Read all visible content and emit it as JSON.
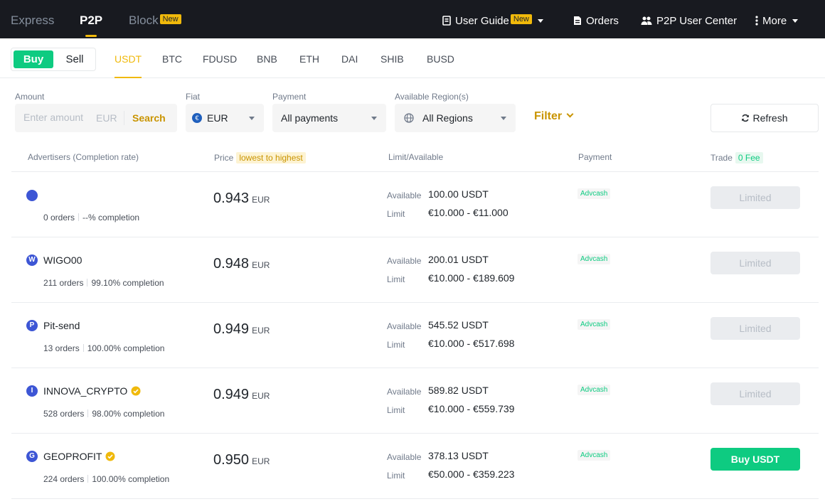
{
  "topnav": {
    "tabs": [
      {
        "label": "Express",
        "active": false
      },
      {
        "label": "P2P",
        "active": true
      },
      {
        "label": "Block",
        "active": false,
        "badge": "New"
      }
    ],
    "right": {
      "user_guide": "User Guide",
      "user_guide_badge": "New",
      "orders": "Orders",
      "p2p_center": "P2P User Center",
      "more": "More"
    }
  },
  "trade_mode": {
    "buy": "Buy",
    "sell": "Sell",
    "active": "Buy"
  },
  "crypto_tabs": [
    "USDT",
    "BTC",
    "FDUSD",
    "BNB",
    "ETH",
    "DAI",
    "SHIB",
    "BUSD"
  ],
  "active_crypto": "USDT",
  "filters": {
    "amount_label": "Amount",
    "amount_placeholder": "Enter amount",
    "amount_unit": "EUR",
    "search": "Search",
    "fiat_label": "Fiat",
    "fiat_value": "EUR",
    "fiat_icon": "€",
    "payment_label": "Payment",
    "payment_value": "All payments",
    "region_label": "Available Region(s)",
    "region_value": "All Regions",
    "filter": "Filter",
    "refresh": "Refresh"
  },
  "table_header": {
    "advertisers": "Advertisers (Completion rate)",
    "price": "Price",
    "price_badge": "lowest to highest",
    "limit": "Limit/Available",
    "payment": "Payment",
    "trade": "Trade",
    "trade_badge": "0 Fee"
  },
  "labels": {
    "available": "Available",
    "limit": "Limit",
    "currency": "EUR"
  },
  "colors": {
    "brand": "#f0b90b",
    "buy": "#0ecb81",
    "nav_bg": "#181a20",
    "avatar": "#3d56d5"
  },
  "rows": [
    {
      "initial": "",
      "name": "",
      "verified": false,
      "orders": "0 orders",
      "completion": "--% completion",
      "price": "0.943",
      "available": "100.00 USDT",
      "limit": "€10.000 - €11.000",
      "payment": "Advcash",
      "action": "Limited",
      "action_type": "limited"
    },
    {
      "initial": "W",
      "name": "WIGO00",
      "verified": false,
      "orders": "211 orders",
      "completion": "99.10% completion",
      "price": "0.948",
      "available": "200.01 USDT",
      "limit": "€10.000 - €189.609",
      "payment": "Advcash",
      "action": "Limited",
      "action_type": "limited"
    },
    {
      "initial": "P",
      "name": "Pit-send",
      "verified": false,
      "orders": "13 orders",
      "completion": "100.00% completion",
      "price": "0.949",
      "available": "545.52 USDT",
      "limit": "€10.000 - €517.698",
      "payment": "Advcash",
      "action": "Limited",
      "action_type": "limited"
    },
    {
      "initial": "I",
      "name": "INNOVA_CRYPTO",
      "verified": true,
      "orders": "528 orders",
      "completion": "98.00% completion",
      "price": "0.949",
      "available": "589.82 USDT",
      "limit": "€10.000 - €559.739",
      "payment": "Advcash",
      "action": "Limited",
      "action_type": "limited"
    },
    {
      "initial": "G",
      "name": "GEOPROFIT",
      "verified": true,
      "orders": "224 orders",
      "completion": "100.00% completion",
      "price": "0.950",
      "available": "378.13 USDT",
      "limit": "€50.000 - €359.223",
      "payment": "Advcash",
      "action": "Buy USDT",
      "action_type": "buy"
    }
  ]
}
